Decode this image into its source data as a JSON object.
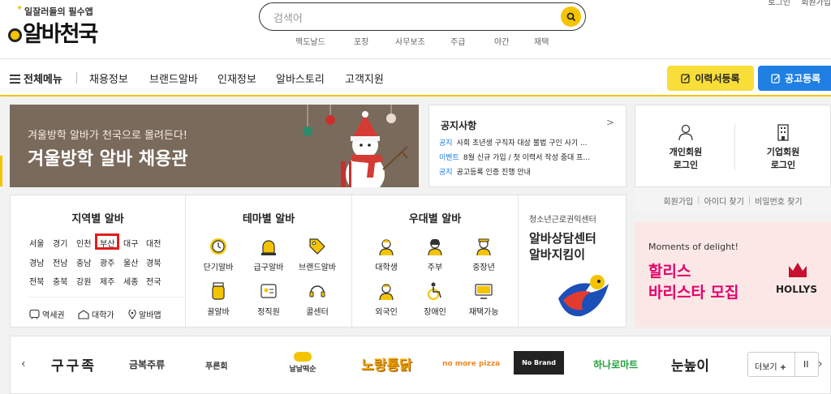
{
  "header": {
    "tagline": "일잘러들의 필수앱",
    "logo_text": "알바천국",
    "search_placeholder": "검색어",
    "keywords": [
      "맥도날드",
      "포장",
      "사무보조",
      "주급",
      "야간",
      "재택"
    ],
    "top_links": [
      "로그인",
      "회원가입"
    ]
  },
  "nav": {
    "all_menu": "전체메뉴",
    "items": [
      "채용정보",
      "브랜드알바",
      "인재정보",
      "알바스토리",
      "고객지원"
    ],
    "resume_button": "이력서등록",
    "post_button": "공고등록"
  },
  "banner": {
    "subtitle": "겨울방학 알바가 천국으로 몰려든다!",
    "title": "겨울방학 알바 채용관"
  },
  "notice": {
    "title": "공지사항",
    "more": ">",
    "items": [
      {
        "tag": "공지",
        "text": "사회 초년생 구직자 대상 불법 구인 사기 ..."
      },
      {
        "tag": "이벤트",
        "text": "8월 신규 가입 / 첫 이력서 작성 중대 프..."
      },
      {
        "tag": "공지",
        "text": "공고등록 인증 진행 안내"
      }
    ]
  },
  "login": {
    "personal": "개인회원",
    "company": "기업회원",
    "login_word": "로그인",
    "links": [
      "회원가입",
      "아이디 찾기",
      "비밀번호 찾기"
    ],
    "sep": "|"
  },
  "ad": {
    "moments": "Moments of delight!",
    "line1": "할리스",
    "line2": "바리스타 모집",
    "brand": "HOLLYS"
  },
  "regions": {
    "title": "지역별 알바",
    "rows": [
      [
        "서울",
        "경기",
        "인천",
        "부산",
        "대구",
        "대전"
      ],
      [
        "경남",
        "전남",
        "충남",
        "광주",
        "울산",
        "경북"
      ],
      [
        "전북",
        "충북",
        "강원",
        "제주",
        "세종",
        "전국"
      ]
    ],
    "extras": [
      "역세권",
      "대학가",
      "알바맵"
    ]
  },
  "themes": {
    "title": "테마별 알바",
    "items": [
      "단기알바",
      "급구알바",
      "브랜드알바",
      "꿀알바",
      "정직원",
      "콜센터"
    ]
  },
  "preferences": {
    "title": "우대별 알바",
    "items": [
      "대학생",
      "주부",
      "중장년",
      "외국인",
      "장애인",
      "재택가능"
    ]
  },
  "youth": {
    "subtitle": "청소년근로권익센터",
    "line1": "알바상담센터",
    "line2": "알바지킴이"
  },
  "brands": {
    "names": [
      "구구족",
      "금복주류",
      "푸른회",
      "날날떡순",
      "노랑통닭",
      "no more pizza",
      "No Brand",
      "하나로마트",
      "눈높이"
    ],
    "more": "더보기",
    "plus": "+",
    "pause": "II",
    "prev": "‹",
    "next": "›"
  }
}
